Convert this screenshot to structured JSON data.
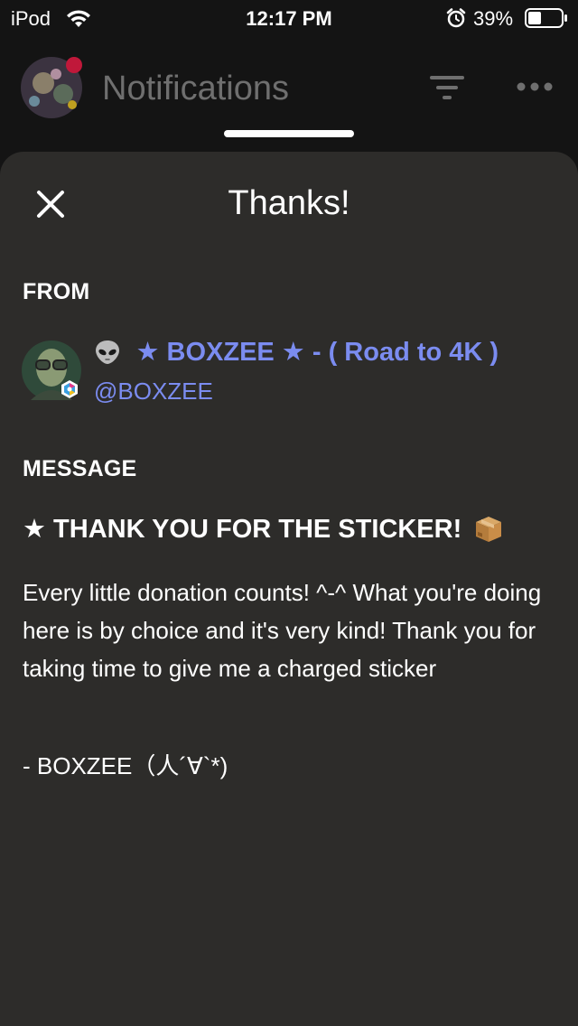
{
  "status_bar": {
    "carrier": "iPod",
    "time": "12:17 PM",
    "battery_percent": "39%"
  },
  "background_header": {
    "title": "Notifications"
  },
  "sheet": {
    "title": "Thanks!",
    "from_label": "FROM",
    "sender": {
      "name": "★ BOXZEE ★ - ( Road to 4K )",
      "handle": "@BOXZEE",
      "name_color": "#7b8cf0"
    },
    "message_label": "MESSAGE",
    "message": {
      "heading": "★ THANK YOU FOR THE STICKER!",
      "body": "Every little donation counts! ^-^ What you're doing here is by choice and it's very kind! Thank you for taking time to give me a charged sticker",
      "signoff": "- BOXZEE（人´∀`*)"
    }
  },
  "icons": {
    "wifi": "wifi-icon",
    "alarm": "alarm-icon",
    "battery": "battery-icon",
    "filter": "filter-icon",
    "more": "more-icon",
    "close": "close-icon",
    "alien": "alien-emoji-icon",
    "package": "package-emoji-icon"
  },
  "colors": {
    "background": "#141414",
    "sheet": "#2d2c2a",
    "accent_link": "#7b8cf0",
    "muted_title": "#6f6f6f"
  }
}
